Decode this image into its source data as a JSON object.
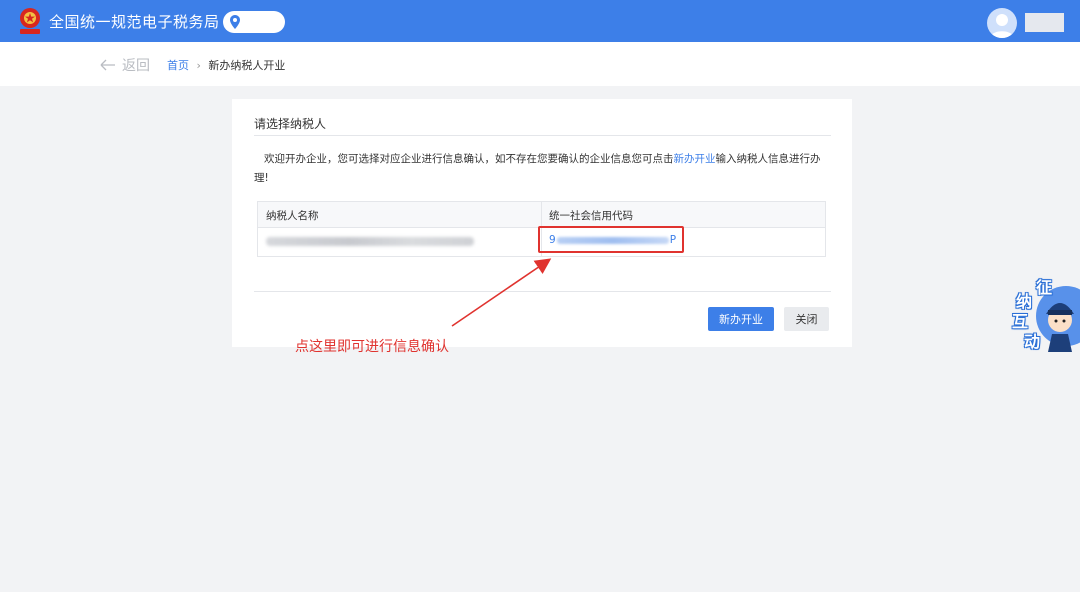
{
  "header": {
    "title": "全国统一规范电子税务局",
    "logo_icon": "tax-emblem-icon",
    "location_icon": "location-pin-icon",
    "avatar_icon": "user-avatar-icon",
    "accent_color": "#3d7fe8"
  },
  "nav": {
    "back_label": "返回",
    "breadcrumb_home": "首页",
    "breadcrumb_separator": "›",
    "breadcrumb_current": "新办纳税人开业"
  },
  "card": {
    "title": "请选择纳税人",
    "intro_before": "欢迎开办企业，您可选择对应企业进行信息确认，如不存在您要确认的企业信息您可点击",
    "intro_link": "新办开业",
    "intro_after": "输入纳税人信息进行办理!",
    "table": {
      "headers": [
        "纳税人名称",
        "统一社会信用代码"
      ],
      "rows": [
        {
          "code_prefix": "9",
          "code_suffix": "P"
        }
      ]
    },
    "buttons": {
      "new_label": "新办开业",
      "close_label": "关闭"
    }
  },
  "annotation": {
    "text": "点这里即可进行信息确认",
    "color": "#e0332f"
  },
  "float_widget": {
    "chars": [
      "征",
      "纳",
      "互",
      "动"
    ]
  }
}
